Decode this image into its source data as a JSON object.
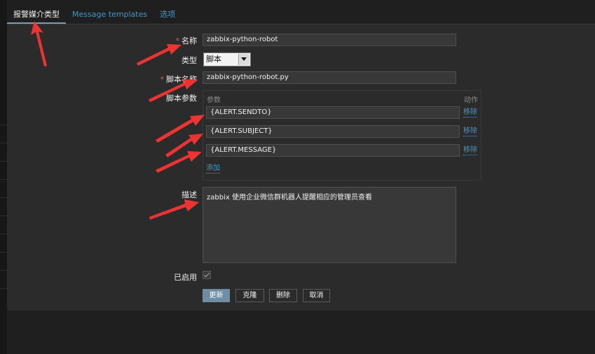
{
  "tabs": [
    {
      "label": "报警媒介类型"
    },
    {
      "label": "Message templates"
    },
    {
      "label": "选项"
    }
  ],
  "form": {
    "required_mark": "*",
    "name_label": "名称",
    "name_value": "zabbix-python-robot",
    "type_label": "类型",
    "type_value": "脚本",
    "script_name_label": "脚本名称",
    "script_name_value": "zabbix-python-robot.py",
    "script_params_label": "脚本参数",
    "params_header": "参数",
    "action_header": "动作",
    "params": [
      {
        "value": "{ALERT.SENDTO}",
        "remove": "移除"
      },
      {
        "value": "{ALERT.SUBJECT}",
        "remove": "移除"
      },
      {
        "value": "{ALERT.MESSAGE}",
        "remove": "移除"
      }
    ],
    "add_label": "添加",
    "description_label": "描述",
    "description_value": "zabbix 使用企业微信群机器人提醒相应的管理员查看",
    "enabled_label": "已启用"
  },
  "buttons": {
    "update": "更新",
    "clone": "克隆",
    "delete": "删除",
    "cancel": "取消"
  },
  "colors": {
    "accent": "#4796c4",
    "arrow": "#ee3333",
    "required": "#e45959",
    "primary_button": "#6f8da5"
  }
}
